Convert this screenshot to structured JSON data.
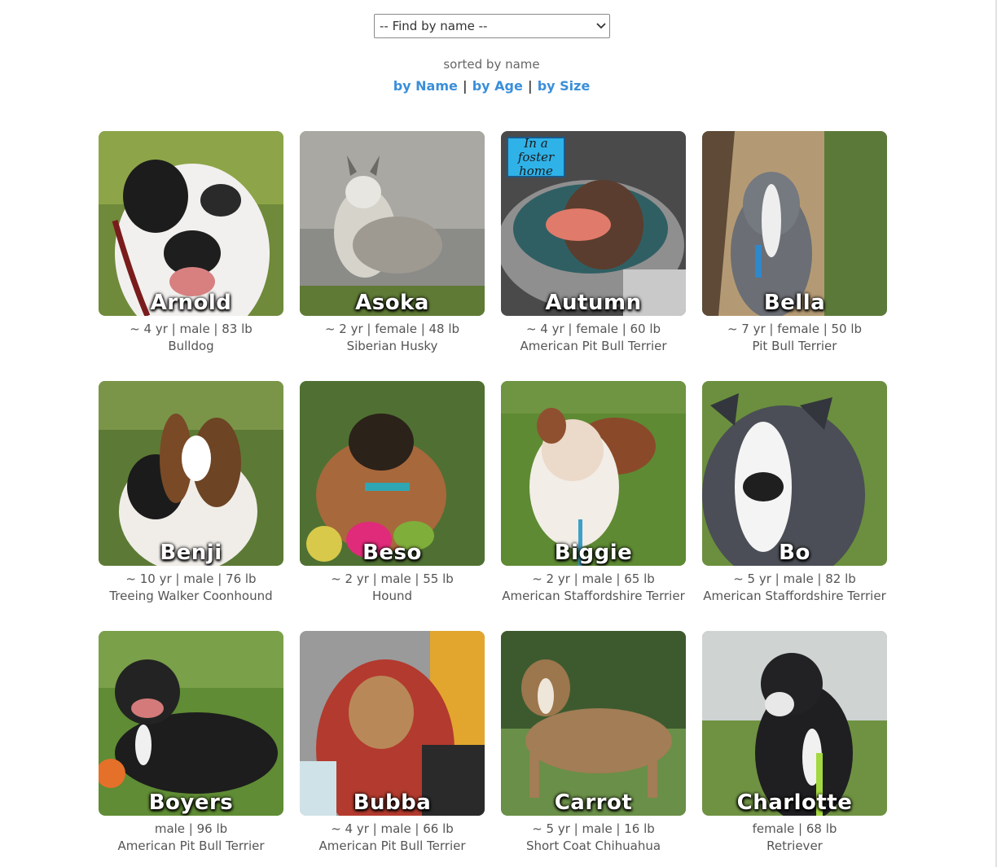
{
  "finder": {
    "placeholder": "-- Find by name --"
  },
  "sorting": {
    "status": "sorted by name",
    "by_name": "by Name",
    "by_age": "by Age",
    "by_size": "by Size",
    "separator": "|"
  },
  "dogs": [
    {
      "name": "Arnold",
      "stats": "~ 4 yr | male | 83 lb",
      "breed": "Bulldog"
    },
    {
      "name": "Asoka",
      "stats": "~ 2 yr | female | 48 lb",
      "breed": "Siberian Husky"
    },
    {
      "name": "Autumn",
      "stats": "~ 4 yr | female | 60 lb",
      "breed": "American Pit Bull Terrier",
      "badge": "In a foster home"
    },
    {
      "name": "Bella",
      "stats": "~ 7 yr | female | 50 lb",
      "breed": "Pit Bull Terrier"
    },
    {
      "name": "Benji",
      "stats": "~ 10 yr | male | 76 lb",
      "breed": "Treeing Walker Coonhound"
    },
    {
      "name": "Beso",
      "stats": "~ 2 yr | male | 55 lb",
      "breed": "Hound"
    },
    {
      "name": "Biggie",
      "stats": "~ 2 yr | male | 65 lb",
      "breed": "American Staffordshire Terrier"
    },
    {
      "name": "Bo",
      "stats": "~ 5 yr | male | 82 lb",
      "breed": "American Staffordshire Terrier"
    },
    {
      "name": "Boyers",
      "stats": "male | 96 lb",
      "breed": "American Pit Bull Terrier"
    },
    {
      "name": "Bubba",
      "stats": "~ 4 yr | male | 66 lb",
      "breed": "American Pit Bull Terrier"
    },
    {
      "name": "Carrot",
      "stats": "~ 5 yr | male | 16 lb",
      "breed": "Short Coat Chihuahua"
    },
    {
      "name": "Charlotte",
      "stats": "female | 68 lb",
      "breed": "Retriever"
    }
  ]
}
